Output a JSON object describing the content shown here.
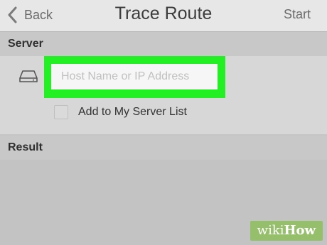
{
  "nav": {
    "back_label": "Back",
    "title": "Trace Route",
    "start_label": "Start"
  },
  "server": {
    "header": "Server",
    "host_input": {
      "placeholder": "Host Name or IP Address",
      "value": ""
    },
    "add_to_list": {
      "label": "Add to My Server List",
      "checked": false
    }
  },
  "result": {
    "header": "Result"
  },
  "watermark": {
    "part1": "wiki",
    "part2": "How"
  },
  "colors": {
    "highlight": "#22f022",
    "watermark_bg": "#96bf6b"
  },
  "icons": [
    "chevron-left-icon",
    "drive-icon"
  ]
}
